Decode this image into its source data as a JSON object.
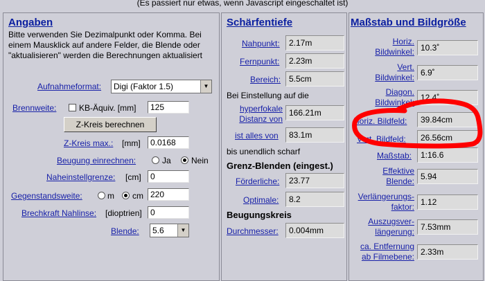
{
  "top_note": "(Es passiert nur etwas, wenn Javascript eingeschaltet ist)",
  "angaben": {
    "title": "Angaben",
    "intro": "Bitte verwenden Sie Dezimalpunkt oder Komma. Bei einem Mausklick auf andere Felder, die Blende oder \"aktualisieren\" werden die Berechnungen aktualisiert",
    "aufnahmeformat_label": "Aufnahmeformat:",
    "aufnahmeformat_value": "Digi (Faktor 1.5)",
    "brennweite_label": "Brennweite:",
    "kb_label": "KB-Äquiv. [mm]",
    "brennweite_value": "125",
    "zkreis_button": "Z-Kreis berechnen",
    "zkreis_label": "Z-Kreis max.:",
    "zkreis_unit": "[mm]",
    "zkreis_value": "0.0168",
    "beugung_label": "Beugung einrechnen:",
    "ja": "Ja",
    "nein": "Nein",
    "naheinstell_label": "Naheinstellgrenze:",
    "naheinstell_unit": "[cm]",
    "naheinstell_value": "0",
    "gegenstand_label": "Gegenstandsweite:",
    "m": "m",
    "cm": "cm",
    "gegenstand_value": "220",
    "brechkraft_label": "Brechkraft Nahlinse:",
    "brechkraft_unit": "[dioptrien]",
    "brechkraft_value": "0",
    "blende_label": "Blende:",
    "blende_value": "5.6"
  },
  "schaerfe": {
    "title": "Schärfentiefe",
    "nahpunkt_label": "Nahpunkt:",
    "nahpunkt_value": "2.17m",
    "fernpunkt_label": "Fernpunkt:",
    "fernpunkt_value": "2.23m",
    "bereich_label": "Bereich:",
    "bereich_value": "5.5cm",
    "einstellung_text": "Bei Einstellung auf die",
    "hyperfokal_line1": "hyperfokale",
    "hyperfokal_line2": "Distanz von",
    "hyperfokal_value": "166.21m",
    "allesvon_label": "ist alles von",
    "allesvon_value": "83.1m",
    "unendlich_text": "bis unendlich scharf",
    "grenz_heading": "Grenz-Blenden (eingest.)",
    "foerderliche_label": "Förderliche:",
    "foerderliche_value": "23.77",
    "optimale_label": "Optimale:",
    "optimale_value": "8.2",
    "beugungskreis_heading": "Beugungskreis",
    "durchmesser_label": "Durchmesser:",
    "durchmesser_value": "0.004mm"
  },
  "massstab": {
    "title": "Maßstab und Bildgröße",
    "horiz_bw_1": "Horiz.",
    "horiz_bw_2": "Bildwinkel:",
    "horiz_bw_value": "10.3˚",
    "vert_bw_1": "Vert.",
    "vert_bw_2": "Bildwinkel:",
    "vert_bw_value": "6.9˚",
    "diag_bw_1": "Diagon.",
    "diag_bw_2": "Bildwinkel:",
    "diag_bw_value": "12.4˚",
    "horiz_bf_label": "Horiz. Bildfeld:",
    "horiz_bf_value": "39.84cm",
    "vert_bf_label": "Vert. Bildfeld:",
    "vert_bf_value": "26.56cm",
    "massstab_label": "Maßstab:",
    "massstab_value": "1:16.6",
    "eff_blende_1": "Effektive",
    "eff_blende_2": "Blende:",
    "eff_blende_value": "5.94",
    "verl_1": "Verlängerungs-",
    "verl_2": "faktor:",
    "verl_value": "1.12",
    "auszug_1": "Auszugsver-",
    "auszug_2": "längerung:",
    "auszug_value": "7.53mm",
    "entf_1": "ca. Entfernung",
    "entf_2": "ab Filmebene:",
    "entf_value": "2.33m"
  },
  "colors": {
    "link": "#1720a8",
    "heading": "#0b1fa0",
    "background": "#cfcfd8",
    "marker": "#ff0000"
  }
}
